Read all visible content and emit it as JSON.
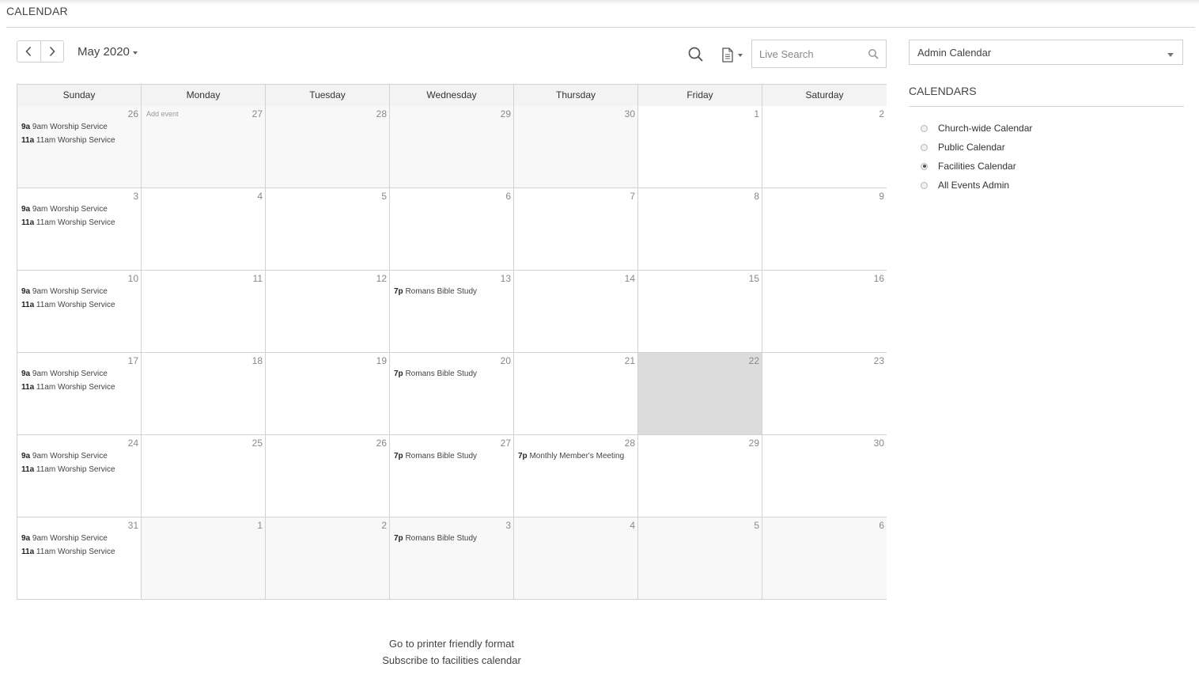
{
  "header": {
    "title": "CALENDAR"
  },
  "toolbar": {
    "month_label": "May 2020",
    "search_placeholder": "Live Search",
    "calendar_select": "Admin Calendar"
  },
  "sidebar": {
    "heading": "CALENDARS",
    "items": [
      {
        "label": "Church-wide Calendar",
        "selected": false
      },
      {
        "label": "Public Calendar",
        "selected": false
      },
      {
        "label": "Facilities Calendar",
        "selected": true
      },
      {
        "label": "All Events Admin",
        "selected": false
      }
    ]
  },
  "calendar": {
    "weekdays": [
      "Sunday",
      "Monday",
      "Tuesday",
      "Wednesday",
      "Thursday",
      "Friday",
      "Saturday"
    ],
    "add_event_label": "Add event",
    "weeks": [
      [
        {
          "day": "26",
          "other": true,
          "events": [
            {
              "time": "9a",
              "title": "9am Worship Service"
            },
            {
              "time": "11a",
              "title": "11am Worship Service"
            }
          ]
        },
        {
          "day": "27",
          "other": true,
          "add_event": true,
          "events": []
        },
        {
          "day": "28",
          "other": true,
          "events": []
        },
        {
          "day": "29",
          "other": true,
          "events": []
        },
        {
          "day": "30",
          "other": true,
          "events": []
        },
        {
          "day": "1",
          "events": []
        },
        {
          "day": "2",
          "events": []
        }
      ],
      [
        {
          "day": "3",
          "events": [
            {
              "time": "9a",
              "title": "9am Worship Service"
            },
            {
              "time": "11a",
              "title": "11am Worship Service"
            }
          ]
        },
        {
          "day": "4",
          "events": []
        },
        {
          "day": "5",
          "events": []
        },
        {
          "day": "6",
          "events": []
        },
        {
          "day": "7",
          "events": []
        },
        {
          "day": "8",
          "events": []
        },
        {
          "day": "9",
          "events": []
        }
      ],
      [
        {
          "day": "10",
          "events": [
            {
              "time": "9a",
              "title": "9am Worship Service"
            },
            {
              "time": "11a",
              "title": "11am Worship Service"
            }
          ]
        },
        {
          "day": "11",
          "events": []
        },
        {
          "day": "12",
          "events": []
        },
        {
          "day": "13",
          "events": [
            {
              "time": "7p",
              "title": "Romans Bible Study"
            }
          ]
        },
        {
          "day": "14",
          "events": []
        },
        {
          "day": "15",
          "events": []
        },
        {
          "day": "16",
          "events": []
        }
      ],
      [
        {
          "day": "17",
          "events": [
            {
              "time": "9a",
              "title": "9am Worship Service"
            },
            {
              "time": "11a",
              "title": "11am Worship Service"
            }
          ]
        },
        {
          "day": "18",
          "events": []
        },
        {
          "day": "19",
          "events": []
        },
        {
          "day": "20",
          "events": [
            {
              "time": "7p",
              "title": "Romans Bible Study"
            }
          ]
        },
        {
          "day": "21",
          "events": []
        },
        {
          "day": "22",
          "today": true,
          "events": []
        },
        {
          "day": "23",
          "events": []
        }
      ],
      [
        {
          "day": "24",
          "events": [
            {
              "time": "9a",
              "title": "9am Worship Service"
            },
            {
              "time": "11a",
              "title": "11am Worship Service"
            }
          ]
        },
        {
          "day": "25",
          "events": []
        },
        {
          "day": "26",
          "events": []
        },
        {
          "day": "27",
          "events": [
            {
              "time": "7p",
              "title": "Romans Bible Study"
            }
          ]
        },
        {
          "day": "28",
          "events": [
            {
              "time": "7p",
              "title": "Monthly Member's Meeting"
            }
          ]
        },
        {
          "day": "29",
          "events": []
        },
        {
          "day": "30",
          "events": []
        }
      ],
      [
        {
          "day": "31",
          "events": [
            {
              "time": "9a",
              "title": "9am Worship Service"
            },
            {
              "time": "11a",
              "title": "11am Worship Service"
            }
          ]
        },
        {
          "day": "1",
          "other": true,
          "events": []
        },
        {
          "day": "2",
          "other": true,
          "events": []
        },
        {
          "day": "3",
          "other": true,
          "events": [
            {
              "time": "7p",
              "title": "Romans Bible Study"
            }
          ]
        },
        {
          "day": "4",
          "other": true,
          "events": []
        },
        {
          "day": "5",
          "other": true,
          "events": []
        },
        {
          "day": "6",
          "other": true,
          "events": []
        }
      ]
    ]
  },
  "footer": {
    "printer_link": "Go to printer friendly format",
    "subscribe_link": "Subscribe to facilities calendar"
  }
}
